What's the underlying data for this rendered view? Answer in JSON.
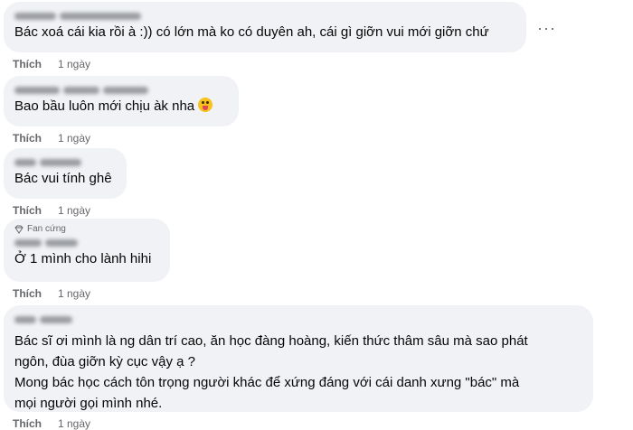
{
  "comments": [
    {
      "author": "Vũ Thị Ngọc Anh",
      "text": "Bác xoá cái kia rồi à :)) có lớn mà ko có duyên ah, cái gì giỡn vui mới giỡn chứ",
      "like": "Thích",
      "time": "1 ngày"
    },
    {
      "author": "Nguyễn Minh Hưng",
      "text": "Bao bầu luôn mới chịu àk nha",
      "emoji": "tongue-face-icon",
      "like": "Thích",
      "time": "1 ngày"
    },
    {
      "author": "Chi Hoàng",
      "text": "Bác vui tính ghê",
      "like": "Thích",
      "time": "1 ngày"
    },
    {
      "badge": "Fan cứng",
      "badge_icon": "diamond-icon",
      "author": "Lan Hương",
      "text": "Ở 1 mình cho lành hihi",
      "like": "Thích",
      "time": "1 ngày"
    },
    {
      "author": "Thu Hà",
      "lines": [
        "Bác sĩ ơi mình là ng dân trí cao, ăn học đàng hoàng, kiến thức thâm sâu mà sao phát",
        "ngôn, đùa giỡn kỳ cục vậy ạ ?",
        "Mong bác học cách tôn trọng người khác để xứng đáng với cái danh xưng \"bác\" mà",
        "mọi người gọi mình nhé."
      ],
      "like": "Thích",
      "time": "1 ngày"
    }
  ],
  "more_label": "···"
}
